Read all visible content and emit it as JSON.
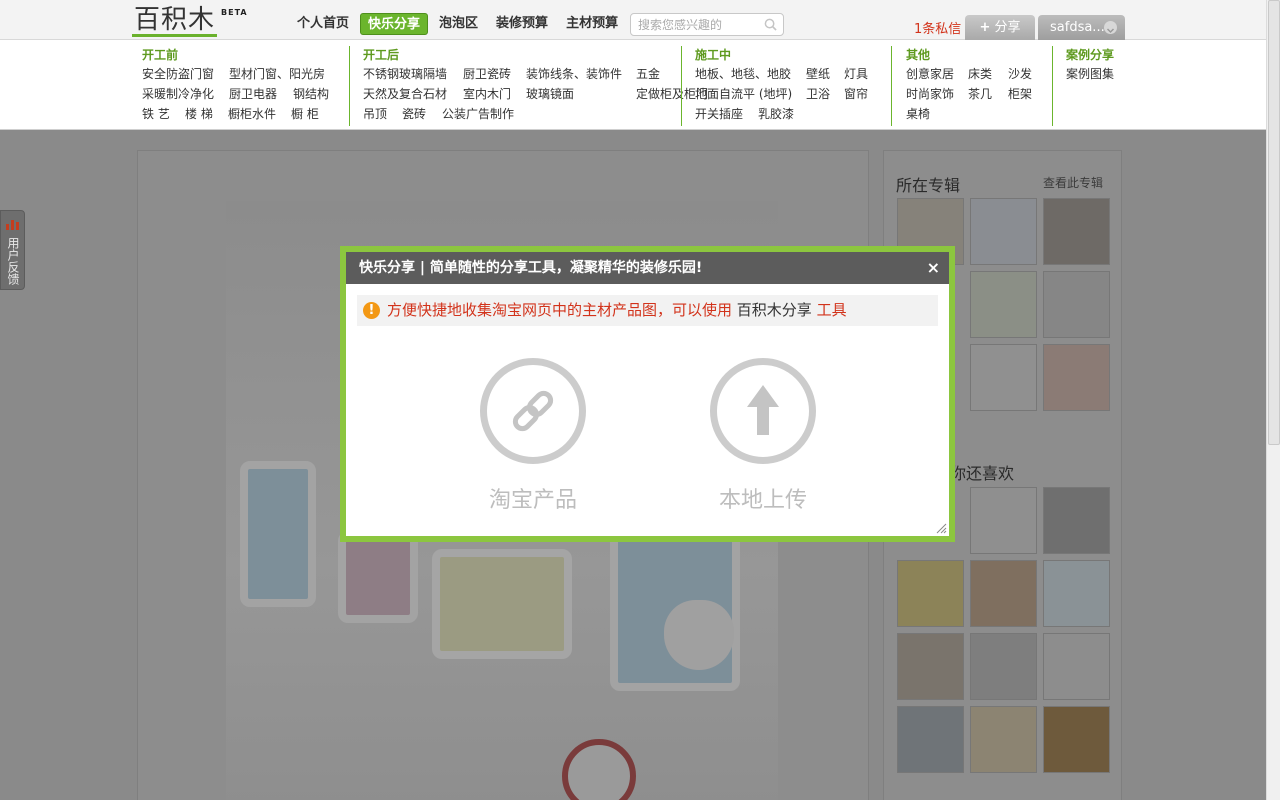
{
  "topbar": {
    "logo_text": "百积木",
    "logo_beta": "BETA",
    "nav": [
      "个人首页",
      "快乐分享",
      "泡泡区",
      "装修预算",
      "主材预算"
    ],
    "nav_active_index": 1,
    "search_placeholder": "搜索您感兴趣的",
    "messages": "1条私信",
    "share_button": "分享",
    "username": "safdsa..."
  },
  "categories": [
    {
      "title": "开工前",
      "links": [
        "安全防盗门窗",
        "型材门窗、阳光房",
        "采暖制冷净化",
        "厨卫电器",
        "钢结构",
        "铁 艺",
        "楼 梯",
        "橱柜水件",
        "橱 柜"
      ]
    },
    {
      "title": "开工后",
      "links": [
        "不锈钢玻璃隔墙",
        "厨卫瓷砖",
        "装饰线条、装饰件",
        "五金",
        "天然及复合石材",
        "室内木门",
        "玻璃镜面",
        "定做柜及柜门",
        "吊顶",
        "瓷砖",
        "公装广告制作"
      ]
    },
    {
      "title": "施工中",
      "links": [
        "地板、地毯、地胶",
        "壁纸",
        "灯具",
        "地面自流平 (地坪)",
        "卫浴",
        "窗帘",
        "开关插座",
        "乳胶漆"
      ]
    },
    {
      "title": "其他",
      "links": [
        "创意家居",
        "床类",
        "沙发",
        "时尚家饰",
        "茶几",
        "柜架",
        "桌椅"
      ]
    },
    {
      "title": "案例分享",
      "links": [
        "案例图集"
      ]
    }
  ],
  "sidebar": {
    "album_title": "所在专辑",
    "album_link": "查看此专辑",
    "like_title": "你还喜欢"
  },
  "feedback": {
    "label": "用户反馈"
  },
  "modal": {
    "title": "快乐分享 | 简单随性的分享工具，凝聚精华的装修乐园!",
    "close": "×",
    "tip_text": "方便快捷地收集淘宝网页中的主材产品图，可以使用",
    "tip_strong": "百积木分享",
    "tip_tool": "工具",
    "option_taobao": "淘宝产品",
    "option_upload": "本地上传"
  },
  "colors": {
    "brand_green": "#6bb52d",
    "modal_border": "#8cc63f",
    "alert_red": "#d2331b",
    "warn_orange": "#f39814"
  }
}
